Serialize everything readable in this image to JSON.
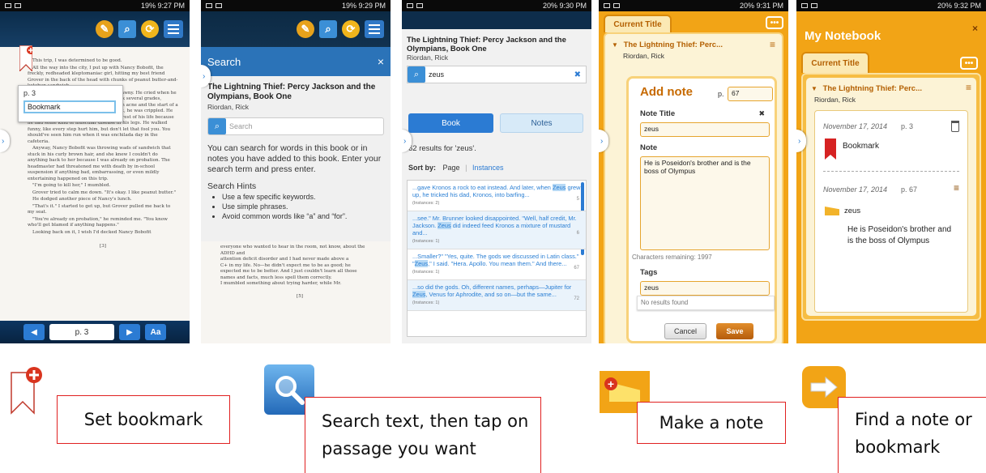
{
  "status": {
    "screen1_time": "9:27 PM",
    "screen1_battery": "19%",
    "screen2_time": "9:29 PM",
    "screen2_battery": "19%",
    "screen3_time": "9:30 PM",
    "screen3_battery": "20%",
    "screen4_time": "9:31 PM",
    "screen4_battery": "20%",
    "screen5_time": "9:32 PM",
    "screen5_battery": "20%"
  },
  "reader": {
    "paragraphs": [
      "This trip, I was determined to be good.",
      "All the way into the city, I put up with Nancy Bobofit, the freckly, redheaded kleptomaniac girl, hitting my best friend Grover in the back of the head with chunks of peanut butter-and-ketchup sandwich.",
      "Grover was an easy target. He was scrawny. He cried when he got frustrated. He must've been held back several grades, because he was the only sixth grader with acne and the start of a wispy beard on his chin. On top of all that, he was crippled. He had a note excusing him from PE for the rest of his life because he had some kind of muscular disease in his legs. He walked funny, like every step hurt him, but don't let that fool you. You should've seen him run when it was enchilada day in the cafeteria.",
      "Anyway, Nancy Bobofit was throwing wads of sandwich that stuck in his curly brown hair, and she knew I couldn't do anything back to her because I was already on probation. The headmaster had threatened me with death by in-school suspension if anything bad, embarrassing, or even mildly entertaining happened on this trip.",
      "\"I'm going to kill her,\" I mumbled.",
      "Grover tried to calm me down. \"It's okay. I like peanut butter.\"",
      "He dodged another piece of Nancy's lunch.",
      "\"That's it.\" I started to get up, but Grover pulled me back to my seat.",
      "\"You're already on probation,\" he reminded me. \"You know who'll get blamed if anything happens.\"",
      "Looking back on it, I wish I'd decked Nancy Bobofit"
    ],
    "page_marker": "[3]",
    "page_field": "p. 3",
    "aa_label": "Aa",
    "bookmark_popup": {
      "page": "p. 3",
      "value": "Bookmark"
    }
  },
  "search_panel": {
    "header": "Search",
    "close": "×",
    "book_title": "The Lightning Thief: Percy Jackson and the Olympians, Book One",
    "author": "Riordan, Rick",
    "placeholder": "Search",
    "instructions": "You can search for words in this book or in notes you have added to this book. Enter your search term and press enter.",
    "hints_title": "Search Hints",
    "hints": [
      "Use a few specific keywords.",
      "Use simple phrases.",
      "Avoid common words like “a” and “for”."
    ],
    "bg_text": [
      "everyone who wanted to hear in the room, not know, about the ADHD and",
      "attention deficit disorder and I had never made above a",
      "C+ in my life. No—he didn't expect me to be as good; he",
      "expected me to be better. And I just couldn't learn all those",
      "names and facts, much less spell them correctly.",
      "I mumbled something about trying harder, while Mr."
    ],
    "page_marker": "[5]"
  },
  "results": {
    "book_title": "The Lightning Thief: Percy Jackson and the Olympians, Book One",
    "author": "Riordan, Rick",
    "query": "zeus",
    "clear": "✖",
    "tab_book": "Book",
    "tab_notes": "Notes",
    "count_text": "62 results for 'zeus'.",
    "sort_label": "Sort by:",
    "sort_page": "Page",
    "sort_instances": "Instances",
    "items": [
      {
        "pre": "...gave Kronos a rock to eat instead. And later, when ",
        "hit": "Zeus",
        "post": " grew up, he tricked his dad, Kronos, into barfing...",
        "inst": "(Instances: 2)",
        "page": "5"
      },
      {
        "pre": "...see.\" Mr. Brunner looked disappointed. \"Well, half credit, Mr. Jackson. ",
        "hit": "Zeus",
        "post": " did indeed feed Kronos a mixture of mustard and...",
        "inst": "(Instances: 1)",
        "page": "6"
      },
      {
        "pre": "...Smaller?\" \"Yes, quite. The gods we discussed in Latin class.\" \"",
        "hit": "Zeus",
        "post": ",\" I said. \"Hera. Apollo. You mean them.\" And there...",
        "inst": "(Instances: 1)",
        "page": "67"
      },
      {
        "pre": "...so did the gods. Oh, different names, perhaps—Jupiter for ",
        "hit": "Zeus",
        "post": ", Venus for Aphrodite, and so on—but the same...",
        "inst": "(Instances: 1)",
        "page": "72"
      }
    ]
  },
  "add_note": {
    "tab": "Current Title",
    "dots": "•••",
    "book_short": "The Lightning Thief: Perc...",
    "author": "Riordan, Rick",
    "heading": "Add note",
    "page_label": "p.",
    "page_value": "67",
    "note_title_label": "Note Title",
    "note_title_value": "zeus",
    "clear": "✖",
    "note_label": "Note",
    "note_value": "He is Poseidon's brother and is the boss of Olympus",
    "remaining": "Characters remaining: 1997",
    "tags_label": "Tags",
    "tags_value": "zeus",
    "no_results": "No results found",
    "cancel": "Cancel",
    "save": "Save"
  },
  "notebook": {
    "title": "My Notebook",
    "close": "×",
    "tab": "Current Title",
    "dots": "•••",
    "book_short": "The Lightning Thief: Perc...",
    "author": "Riordan, Rick",
    "entry1_date": "November 17, 2014",
    "entry1_page": "p. 3",
    "entry1_label": "Bookmark",
    "entry2_date": "November 17, 2014",
    "entry2_page": "p. 67",
    "entry2_title": "zeus",
    "entry2_text": "He is Poseidon's brother and is the boss of Olympus"
  },
  "legend": {
    "bookmark": "Set bookmark",
    "search": "Search text, then tap on passage you want",
    "note": "Make a note",
    "find": "Find a note or bookmark"
  },
  "colors": {
    "accent_blue": "#2b73b8",
    "orange": "#f2a416",
    "red_outline": "#e02020"
  }
}
